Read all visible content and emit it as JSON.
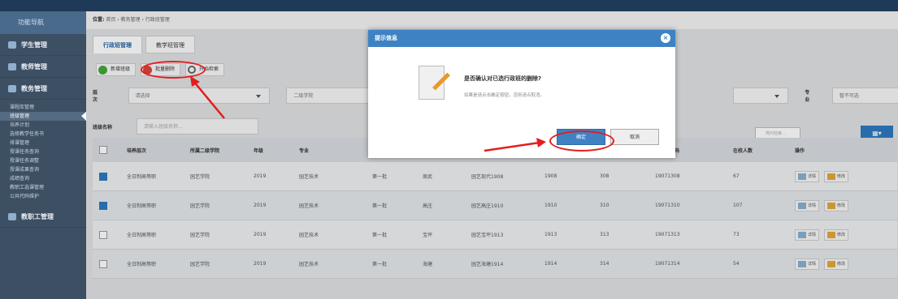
{
  "sidebar": {
    "nav_title": "功能导航",
    "groups": [
      {
        "label": "学生管理"
      },
      {
        "label": "教师管理"
      },
      {
        "label": "教务管理"
      }
    ],
    "sub_items": [
      "课程库管理",
      "班级管理",
      "培养计划",
      "选修教学任务书",
      "排课管理",
      "授课任务查询",
      "授课任务调整",
      "授课成果查询",
      "成绩查询",
      "教职工选课管理",
      "公共代码维护"
    ],
    "bottom_group": "教职工管理"
  },
  "breadcrumb": {
    "prefix": "位置:",
    "path": "首页 › 教务管理 › 行政班管理"
  },
  "tabs": [
    "行政班管理",
    "教学班管理"
  ],
  "toolbar": {
    "add": "新增班级",
    "batch_delete": "批量删除",
    "search": "开始检索"
  },
  "filters": {
    "level_label": "层 次",
    "level_value": "请选择",
    "dept_placeholder": "二级学院",
    "major_label": "专 业",
    "major_value": "暂不可选",
    "name_label": "班级名称",
    "name_placeholder": "请输入班级名称...",
    "search_placeholder": "简内检索..."
  },
  "table": {
    "headers": [
      "培养层次",
      "所属二级学院",
      "年级",
      "专业",
      "",
      "",
      "",
      "",
      "",
      "行政班编码",
      "在校人数",
      "操作"
    ],
    "rows": [
      {
        "checked": true,
        "c": [
          "全日制高等职",
          "园艺学院",
          "2019",
          "园艺技术",
          "第一批",
          "周武",
          "园艺现代1908",
          "1908",
          "308",
          "19071308",
          "67"
        ]
      },
      {
        "checked": true,
        "c": [
          "全日制高等职",
          "园艺学院",
          "2019",
          "园艺技术",
          "第一批",
          "高庄",
          "园艺高庄1910",
          "1910",
          "310",
          "19071310",
          "107"
        ]
      },
      {
        "checked": false,
        "c": [
          "全日制高等职",
          "园艺学院",
          "2019",
          "园艺技术",
          "第一批",
          "宝坪",
          "园艺宝坪1913",
          "1913",
          "313",
          "19071313",
          "73"
        ]
      },
      {
        "checked": false,
        "c": [
          "全日制高等职",
          "园艺学院",
          "2019",
          "园艺技术",
          "第一批",
          "海塘",
          "园艺海塘1914",
          "1914",
          "314",
          "19071314",
          "54"
        ]
      }
    ],
    "op_view": "详情",
    "op_edit": "修改"
  },
  "modal": {
    "title": "提示信息",
    "question": "是否确认对已选行政班的删除?",
    "hint": "如果是请点击确定按钮，否则请点取消。",
    "ok": "确定",
    "cancel": "取消"
  }
}
